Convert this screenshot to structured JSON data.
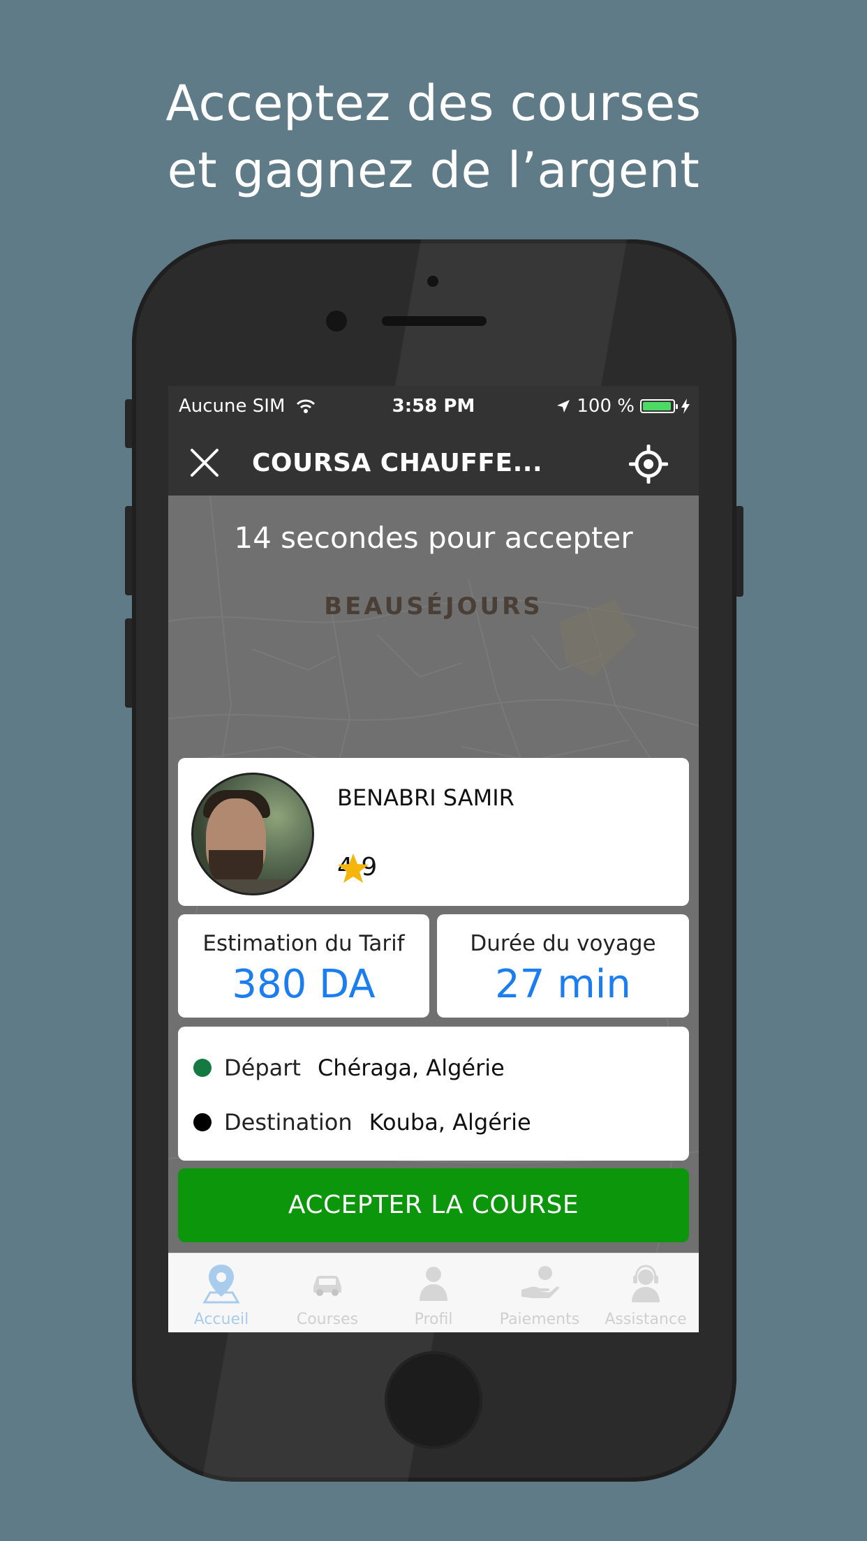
{
  "headline": {
    "line1": "Acceptez des courses",
    "line2": "et gagnez de l’argent"
  },
  "status_bar": {
    "carrier": "Aucune SIM",
    "time": "3:58 PM",
    "battery": "100 %",
    "battery_level": 1.0
  },
  "nav": {
    "title": "COURSA CHAUFFE...",
    "close_icon": "close-icon",
    "locate_icon": "locate-icon"
  },
  "map": {
    "countdown": "14 secondes pour accepter",
    "district": "BEAUSÉJOURS"
  },
  "rider": {
    "name": "BENABRI SAMIR",
    "rating": "4.9",
    "rating_icon": "star-icon"
  },
  "fare": {
    "label": "Estimation du Tarif",
    "value": "380 DA"
  },
  "duration": {
    "label": "Durée du voyage",
    "value": "27 min"
  },
  "route": {
    "departure_label": "Départ",
    "departure_value": "Chéraga, Algérie",
    "destination_label": "Destination",
    "destination_value": "Kouba, Algérie"
  },
  "accept_button": "ACCEPTER LA COURSE",
  "tabs": [
    {
      "label": "Accueil",
      "icon": "map-pin-icon",
      "active": true
    },
    {
      "label": "Courses",
      "icon": "car-icon",
      "active": false
    },
    {
      "label": "Profil",
      "icon": "person-icon",
      "active": false
    },
    {
      "label": "Paiements",
      "icon": "payment-icon",
      "active": false
    },
    {
      "label": "Assistance",
      "icon": "headset-icon",
      "active": false
    }
  ],
  "colors": {
    "background": "#5f7b88",
    "accent_blue": "#1a7df1",
    "accept_green": "#0b960b",
    "departure_dot": "#157a42",
    "destination_dot": "#000000",
    "star": "#f5b50a"
  }
}
